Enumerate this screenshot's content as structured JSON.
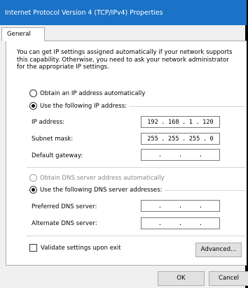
{
  "window": {
    "title": "Internet Protocol Version 4 (TCP/IPv4) Properties",
    "title_bar_color": "#1b72c6"
  },
  "tabs": [
    {
      "label": "General",
      "selected": true
    }
  ],
  "intro_lines": [
    "You can get IP settings assigned automatically if your network supports",
    "this capability. Otherwise, you need to ask your network administrator",
    "for the appropriate IP settings."
  ],
  "ip_section": {
    "auto_label": "Obtain an IP address automatically",
    "auto_checked": false,
    "manual_label": "Use the following IP address:",
    "manual_checked": true,
    "fields": [
      {
        "label": "IP address:",
        "octets": [
          "192",
          "168",
          "1",
          "120"
        ]
      },
      {
        "label": "Subnet mask:",
        "octets": [
          "255",
          "255",
          "255",
          "0"
        ]
      },
      {
        "label": "Default gateway:",
        "octets": [
          "",
          "",
          "",
          ""
        ]
      }
    ]
  },
  "dns_section": {
    "auto_label": "Obtain DNS server address automatically",
    "auto_checked": false,
    "auto_disabled": true,
    "manual_label": "Use the following DNS server addresses:",
    "manual_checked": true,
    "fields": [
      {
        "label": "Preferred DNS server:",
        "octets": [
          "",
          "",
          "",
          ""
        ]
      },
      {
        "label": "Alternate DNS server:",
        "octets": [
          "",
          "",
          "",
          ""
        ]
      }
    ]
  },
  "validate": {
    "label": "Validate settings upon exit",
    "checked": false
  },
  "buttons": {
    "advanced": "Advanced...",
    "ok": "OK",
    "cancel": "Cancel"
  },
  "ip_separator": "."
}
